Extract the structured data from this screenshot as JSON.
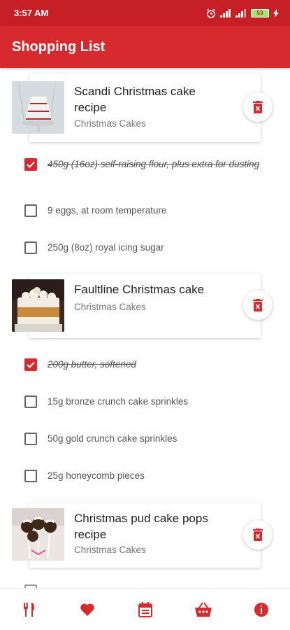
{
  "status_bar": {
    "time": "3:57 AM",
    "battery": "53"
  },
  "app": {
    "title": "Shopping List"
  },
  "recipes": [
    {
      "title": "Scandi Christmas cake recipe",
      "category": "Christmas Cakes",
      "ingredients": [
        {
          "text": "450g (16oz) self-raising flour, plus extra for dusting",
          "checked": true
        },
        {
          "text": "9 eggs, at room temperature",
          "checked": false
        },
        {
          "text": "250g (8oz) royal icing sugar",
          "checked": false
        }
      ]
    },
    {
      "title": "Faultline Christmas cake",
      "category": "Christmas Cakes",
      "ingredients": [
        {
          "text": "200g butter, softened",
          "checked": true
        },
        {
          "text": "15g bronze crunch cake sprinkles",
          "checked": false
        },
        {
          "text": "50g gold crunch cake sprinkles",
          "checked": false
        },
        {
          "text": "25g honeycomb pieces",
          "checked": false
        }
      ]
    },
    {
      "title": "Christmas pud cake pops recipe",
      "category": "Christmas Cakes",
      "ingredients": []
    }
  ],
  "colors": {
    "primary": "#d62a2e",
    "status_bar": "#c62026"
  },
  "bottom_nav": [
    {
      "icon": "recipes-icon"
    },
    {
      "icon": "favorites-icon"
    },
    {
      "icon": "planner-icon"
    },
    {
      "icon": "shopping-basket-icon"
    },
    {
      "icon": "info-icon"
    }
  ]
}
